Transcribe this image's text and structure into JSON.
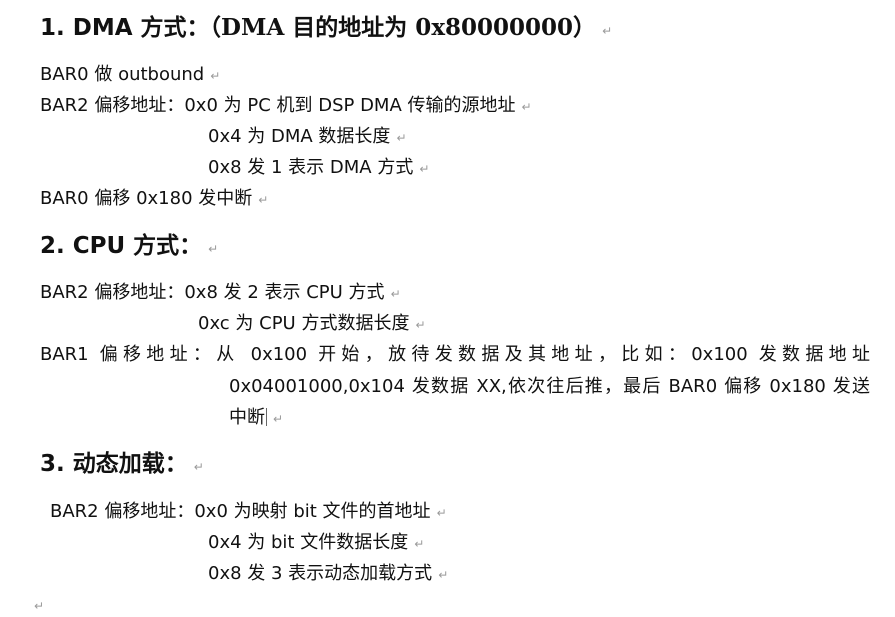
{
  "paragraph_mark": "↵",
  "sections": [
    {
      "heading_prefix": "1.  DMA 方式：",
      "heading_suffix": "（DMA 目的地址为 0x80000000）",
      "lines": [
        "BAR0 做 outbound",
        "BAR2 偏移地址：0x0 为 PC 机到 DSP DMA 传输的源地址",
        "0x4 为 DMA 数据长度",
        "0x8 发 1 表示 DMA 方式",
        "BAR0 偏移 0x180 发中断"
      ]
    },
    {
      "heading": "2.  CPU 方式：",
      "lines": [
        "BAR2 偏移地址：0x8 发 2 表示 CPU 方式",
        "0xc 为 CPU 方式数据长度",
        "BAR1  偏移地址：从  0x100  开始，放待发数据及其地址，比如：0x100  发数据地址",
        "0x04001000,0x104 发数据 XX,依次往后推，最后 BAR0 偏移 0x180 发送",
        "中断"
      ]
    },
    {
      "heading": "3.  动态加载：",
      "lines": [
        "BAR2 偏移地址：0x0 为映射 bit 文件的首地址",
        "0x4 为 bit 文件数据长度",
        "0x8 发 3 表示动态加载方式"
      ]
    }
  ]
}
